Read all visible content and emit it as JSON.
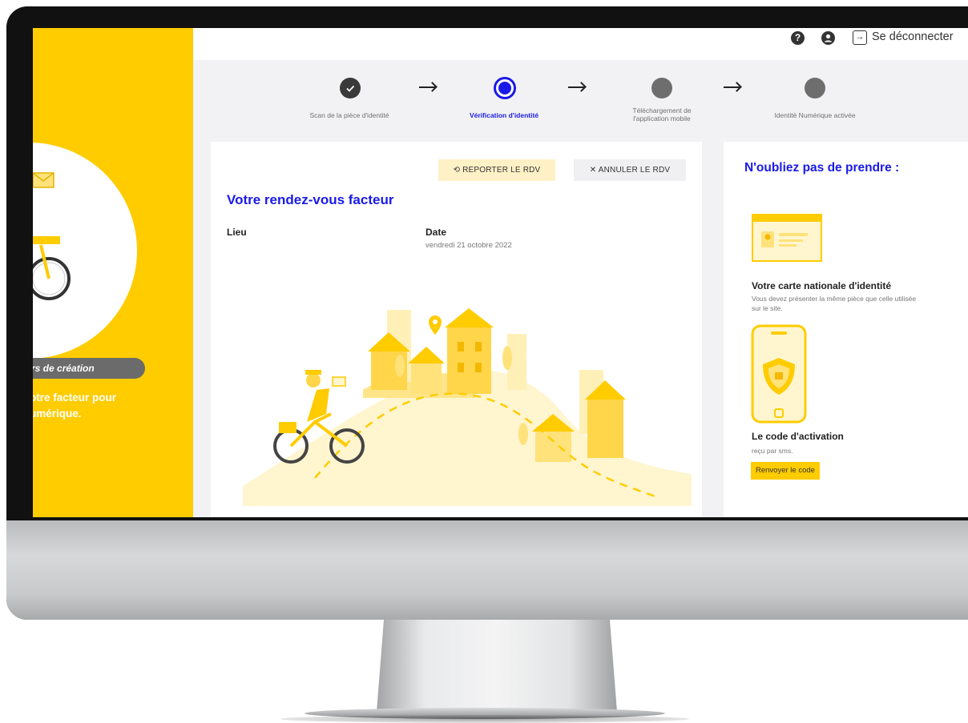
{
  "top_bar": {
    "help_icon": "question-circle-icon",
    "account_icon": "user-circle-icon",
    "logout_icon": "sign-out-icon",
    "logout_label": "Se déconnecter"
  },
  "stepper": {
    "steps": [
      {
        "label": "Scan de la pièce d'identité",
        "state": "completed"
      },
      {
        "label": "Vérification d'identité",
        "state": "active"
      },
      {
        "label_line1": "Téléchargement de",
        "label_line2": "l'application mobile",
        "state": "pending"
      },
      {
        "label": "Identité Numérique activée",
        "state": "pending"
      }
    ]
  },
  "left_panel": {
    "pill_text": "rs de création",
    "text_line1": "otre facteur pour",
    "text_line2": "umérique."
  },
  "appointment": {
    "reschedule_label": "REPORTER LE RDV",
    "cancel_label": "ANNULER LE RDV",
    "title": "Votre rendez-vous facteur",
    "place_label": "Lieu",
    "date_label": "Date",
    "date_value": "vendredi 21 octobre 2022"
  },
  "reminder": {
    "title": "N'oubliez pas de prendre :",
    "id_card_title": "Votre carte nationale d'identité",
    "id_card_text": "Vous devez présenter la même pièce que celle utilisée sur le site.",
    "code_title": "Le code d'activation",
    "code_text": "reçu par sms.",
    "resend_label": "Renvoyer le code"
  },
  "colors": {
    "brand_yellow": "#ffcc00",
    "accent_blue": "#1a1ae8",
    "completed_step": "#3a3a3a",
    "pending_step": "#6e6e6e"
  }
}
